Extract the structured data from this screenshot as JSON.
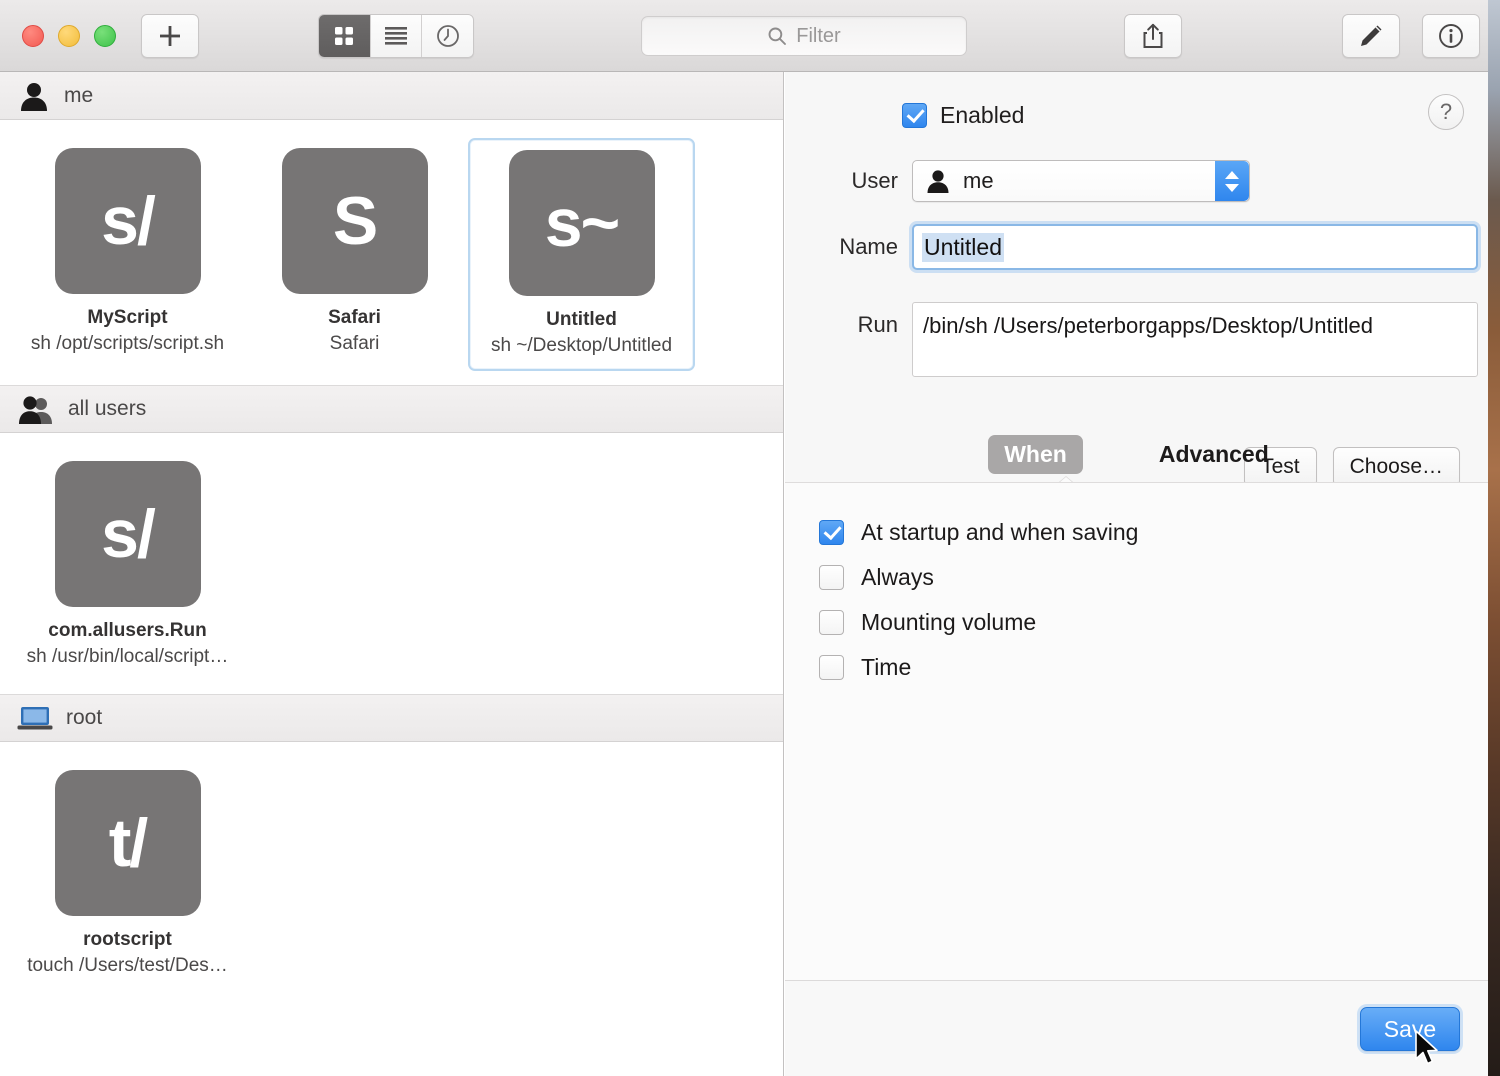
{
  "toolbar": {
    "add_label": "+",
    "add_icon": "plus-icon",
    "view_grid_icon": "grid-view-icon",
    "view_list_icon": "list-view-icon",
    "view_clock_icon": "history-clock-icon",
    "share_icon": "share-icon",
    "edit_icon": "pencil-edit-icon",
    "info_icon": "info-circle-icon",
    "search_icon": "search-icon",
    "filter_placeholder": "Filter",
    "filter_value": ""
  },
  "sidebar": {
    "groups": [
      {
        "label": "me",
        "icon": "single-user-icon",
        "items": [
          {
            "glyph": "s/",
            "title": "MyScript",
            "subtitle": "sh /opt/scripts/script.sh",
            "selected": false
          },
          {
            "glyph": "S",
            "title": "Safari",
            "subtitle": "Safari",
            "selected": false
          },
          {
            "glyph": "s~",
            "title": "Untitled",
            "subtitle": "sh ~/Desktop/Untitled",
            "selected": true
          }
        ]
      },
      {
        "label": "all users",
        "icon": "multiple-users-icon",
        "items": [
          {
            "glyph": "s/",
            "title": "com.allusers.Run",
            "subtitle": "sh /usr/bin/local/script…",
            "selected": false
          }
        ]
      },
      {
        "label": "root",
        "icon": "computer-icon",
        "items": [
          {
            "glyph": "t/",
            "title": "rootscript",
            "subtitle": "touch /Users/test/Des…",
            "selected": false
          }
        ]
      }
    ]
  },
  "inspector": {
    "help_label": "?",
    "enabled_label": "Enabled",
    "enabled_checked": true,
    "user_label": "User",
    "user_value": "me",
    "user_icon": "single-user-icon",
    "name_label": "Name",
    "name_value": "Untitled",
    "name_placeholder": "",
    "run_label": "Run",
    "run_value": "/bin/sh /Users/peterborgapps/Desktop/Untitled",
    "test_label": "Test",
    "choose_label": "Choose…",
    "tabs": [
      {
        "label": "When",
        "active": true
      },
      {
        "label": "Advanced",
        "active": false
      }
    ],
    "when_options": [
      {
        "label": "At startup and when saving",
        "checked": true
      },
      {
        "label": "Always",
        "checked": false
      },
      {
        "label": "Mounting volume",
        "checked": false
      },
      {
        "label": "Time",
        "checked": false
      }
    ],
    "save_label": "Save"
  },
  "colors": {
    "accent_blue": "#2f86ee",
    "icon_tile_gray": "#777575",
    "selection_border": "#b9d7f0",
    "tab_active_bg": "#a9a7a7"
  }
}
